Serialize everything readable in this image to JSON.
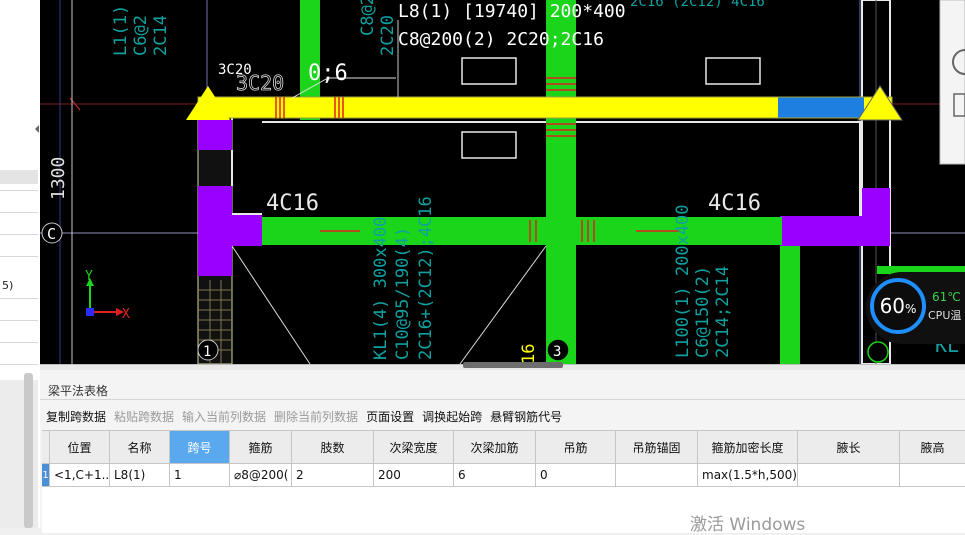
{
  "left_panel": {
    "row_text": "5)"
  },
  "canvas": {
    "beam_text_line1": "L8(1) [19740] 200*400",
    "beam_text_line2": "C8@200(2) 2C20;2C16",
    "upper_label": "3C20",
    "upper_label2": "3C20",
    "gap_label": "0;6",
    "rebar_label_left": "4C16",
    "rebar_label_right": "4C16",
    "dim_1300": "1300",
    "grid_c": "C",
    "grid_1": "1",
    "grid_3": "3",
    "axis_y": "Y",
    "axis_x": "X",
    "vert_text_a": "KL1(4) 300x400",
    "vert_text_b": "C10@95/190(4)",
    "vert_text_c": "2C16+(2C12);4C16",
    "vert_text_d": "L100(1) 200x400",
    "vert_text_e": "C6@150(2)",
    "vert_text_f": "2C14;2C14",
    "vert_text_g": "L1(1)",
    "vert_text_h": "C6@2",
    "vert_text_i": "2C14",
    "vert_text_j": "C8@2",
    "vert_text_k": "2C20",
    "vert_text_16": "16",
    "edge_text_kl": "KL",
    "top_right_text": "2C16 (2C12) 4C16"
  },
  "panel": {
    "title": "梁平法表格",
    "toolbar": [
      {
        "label": "复制跨数据",
        "enabled": true
      },
      {
        "label": "粘贴跨数据",
        "enabled": false
      },
      {
        "label": "输入当前列数据",
        "enabled": false
      },
      {
        "label": "删除当前列数据",
        "enabled": false
      },
      {
        "label": "页面设置",
        "enabled": true
      },
      {
        "label": "调换起始跨",
        "enabled": true
      },
      {
        "label": "悬臂钢筋代号",
        "enabled": true
      }
    ],
    "columns": [
      "位置",
      "名称",
      "跨号",
      "箍筋",
      "肢数",
      "次梁宽度",
      "次梁加筋",
      "吊筋",
      "吊筋锚固",
      "箍筋加密长度",
      "腋长",
      "腋高"
    ],
    "selected_column": "跨号",
    "rows": [
      [
        "<1,C+1...",
        "L8(1)",
        "1",
        "⌀8@200(",
        "2",
        "200",
        "6",
        "0",
        "",
        "max(1.5*h,500)",
        "",
        ""
      ]
    ],
    "row_number": "1"
  },
  "cpu_widget": {
    "percent": "60",
    "percent_sign": "%",
    "temp": "61℃",
    "label": "CPU温"
  },
  "watermark": "激活 Windows",
  "colors": {
    "beam_yellow": "#ffff00",
    "beam_green": "#1ad51a",
    "column_purple": "#9a00ff",
    "selected_blue": "#1f7fe0",
    "cad_cyan": "#10a0a0"
  }
}
